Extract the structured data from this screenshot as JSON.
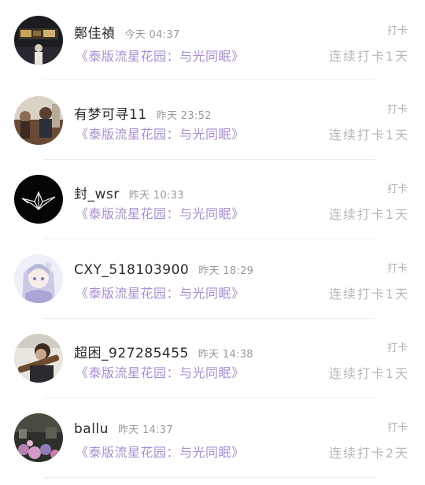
{
  "posts": [
    {
      "name": "鄭佳禎",
      "time": "今天 04:37",
      "title": "《泰版流星花园：与光同眠》",
      "tag": "打卡",
      "streak": "连续打卡1天",
      "avatar": "avatar-photo-icon"
    },
    {
      "name": "有梦可寻11",
      "time": "昨天 23:52",
      "title": "《泰版流星花园：与光同眠》",
      "tag": "打卡",
      "streak": "连续打卡1天",
      "avatar": "avatar-photo-icon"
    },
    {
      "name": "封_wsr",
      "time": "昨天 10:33",
      "title": "《泰版流星花园：与光同眠》",
      "tag": "打卡",
      "streak": "连续打卡1天",
      "avatar": "paper-crane-icon"
    },
    {
      "name": "CXY_518103900",
      "time": "昨天 18:29",
      "title": "《泰版流星花园：与光同眠》",
      "tag": "打卡",
      "streak": "连续打卡1天",
      "avatar": "anime-avatar-icon"
    },
    {
      "name": "超困_927285455",
      "time": "昨天 14:38",
      "title": "《泰版流星花园：与光同眠》",
      "tag": "打卡",
      "streak": "连续打卡1天",
      "avatar": "avatar-photo-icon"
    },
    {
      "name": "ballu",
      "time": "昨天 14:37",
      "title": "《泰版流星花园：与光同眠》",
      "tag": "打卡",
      "streak": "连续打卡2天",
      "avatar": "avatar-photo-icon"
    }
  ]
}
